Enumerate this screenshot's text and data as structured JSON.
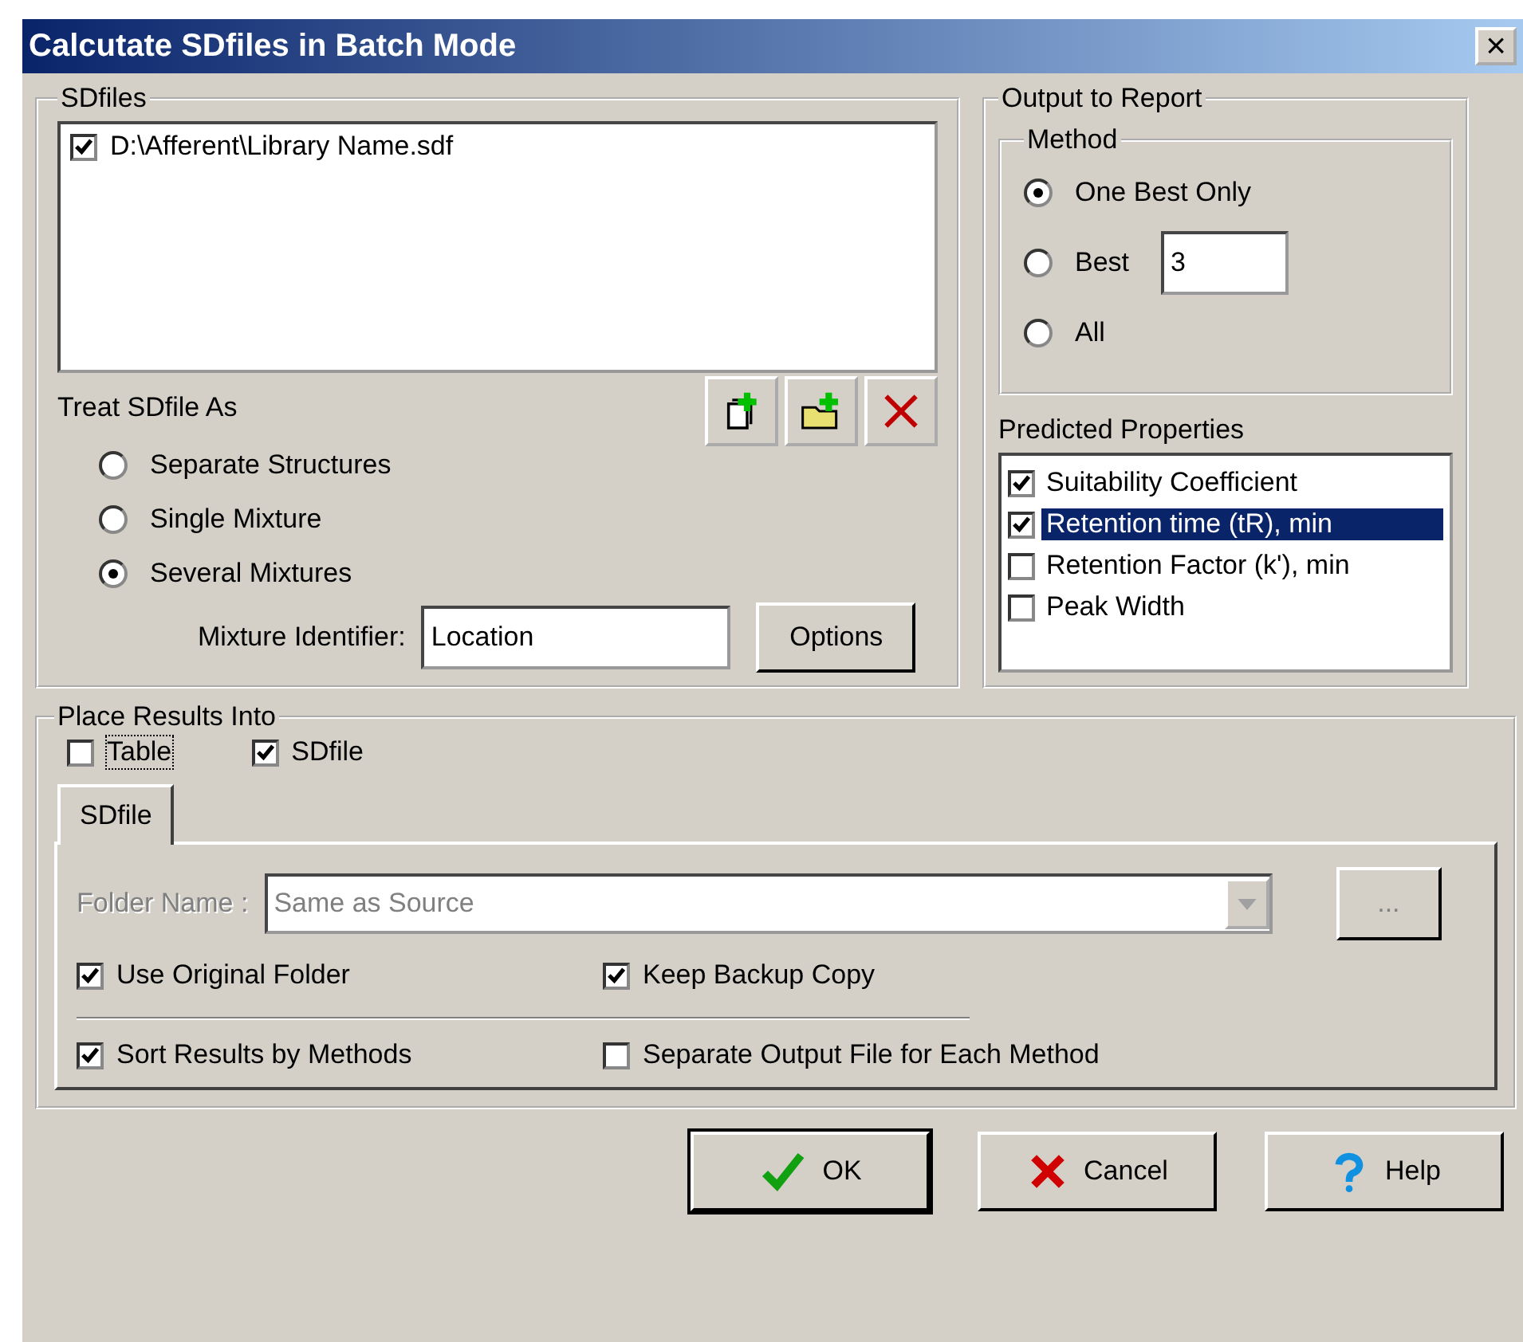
{
  "window": {
    "title": "Calcutate SDfiles in Batch Mode",
    "close": "×"
  },
  "sdfiles": {
    "label": "SDfiles",
    "files": [
      {
        "path": "D:\\Afferent\\Library Name.sdf",
        "checked": true
      }
    ],
    "treat_as": {
      "label": "Treat SDfile As",
      "options": [
        {
          "label": "Separate Structures",
          "selected": false
        },
        {
          "label": "Single Mixture",
          "selected": false
        },
        {
          "label": "Several Mixtures",
          "selected": true
        }
      ]
    },
    "mixture_identifier": {
      "label": "Mixture Identifier:",
      "value": "Location"
    },
    "options_button": "Options"
  },
  "output": {
    "label": "Output to Report",
    "method": {
      "label": "Method",
      "options": [
        {
          "label": "One Best Only",
          "selected": true
        },
        {
          "label": "Best",
          "selected": false,
          "value": "3"
        },
        {
          "label": "All",
          "selected": false
        }
      ]
    },
    "properties": {
      "label": "Predicted Properties",
      "items": [
        {
          "label": "Suitability Coefficient",
          "checked": true,
          "selected": false
        },
        {
          "label": "Retention time (tR), min",
          "checked": true,
          "selected": true
        },
        {
          "label": "Retention Factor (k'), min",
          "checked": false,
          "selected": false
        },
        {
          "label": "Peak Width",
          "checked": false,
          "selected": false
        }
      ]
    }
  },
  "place_results": {
    "label": "Place Results Into",
    "targets": [
      {
        "label": "Table",
        "checked": false
      },
      {
        "label": "SDfile",
        "checked": true
      }
    ],
    "tabs": [
      {
        "label": "SDfile",
        "selected": true
      }
    ],
    "folder_name": {
      "label": "Folder Name :",
      "value": "Same as Source",
      "disabled": true,
      "browse": "..."
    },
    "options": [
      {
        "label": "Use Original Folder",
        "checked": true
      },
      {
        "label": "Keep Backup Copy",
        "checked": true
      }
    ],
    "sort_options": [
      {
        "label": "Sort Results by Methods",
        "checked": true
      },
      {
        "label": "Separate Output File for Each Method",
        "checked": false
      }
    ]
  },
  "buttons": [
    {
      "label": "OK",
      "kind": "ok"
    },
    {
      "label": "Cancel",
      "kind": "cancel"
    },
    {
      "label": "Help",
      "kind": "help"
    }
  ]
}
